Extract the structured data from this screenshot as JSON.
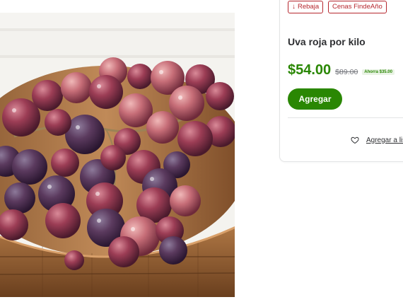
{
  "product": {
    "tags": [
      {
        "label": "Rebaja",
        "icon": "arrow-down-icon"
      },
      {
        "label": "Cenas FindeAño"
      }
    ],
    "title": "Uva roja por kilo",
    "price": {
      "current": "$54.00",
      "was": "$89.00",
      "savings": "Ahorra $35.00"
    },
    "add_button_label": "Agregar",
    "wishlist_label": "Agregar a lis",
    "image_caption": ""
  },
  "colors": {
    "accent_green": "#2a8703",
    "tag_red": "#b5262d"
  }
}
